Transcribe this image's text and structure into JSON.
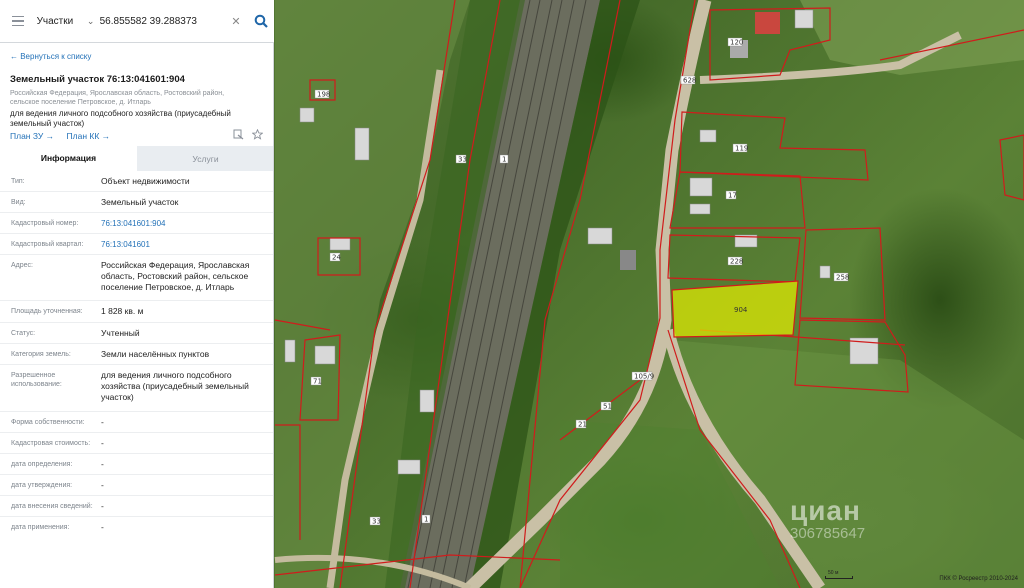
{
  "search": {
    "category": "Участки",
    "query": "56.855582 39.288373"
  },
  "sidebar": {
    "back_link": "← Вернуться к списку",
    "title": "Земельный участок 76:13:041601:904",
    "address": "Российская Федерация, Ярославская область, Ростовский район, сельское поселение Петровское, д. Итларь",
    "purpose": "для ведения личного подсобного хозяйства (приусадебный земельный участок)",
    "plan_links": [
      "План ЗУ →",
      "План КК →"
    ],
    "tabs": [
      {
        "label": "Информация",
        "active": true
      },
      {
        "label": "Услуги",
        "active": false
      }
    ],
    "rows": [
      {
        "label": "Тип:",
        "value": "Объект недвижимости",
        "link": false
      },
      {
        "label": "Вид:",
        "value": "Земельный участок",
        "link": false
      },
      {
        "label": "Кадастровый номер:",
        "value": "76:13:041601:904",
        "link": true
      },
      {
        "label": "Кадастровый квартал:",
        "value": "76:13:041601",
        "link": true
      },
      {
        "label": "Адрес:",
        "value": "Российская Федерация, Ярославская область, Ростовский район, сельское поселение Петровское, д. Итларь",
        "link": false
      },
      {
        "label": "Площадь уточненная:",
        "value": "1 828 кв. м",
        "link": false
      },
      {
        "label": "Статус:",
        "value": "Учтенный",
        "link": false
      },
      {
        "label": "Категория земель:",
        "value": "Земли населённых пунктов",
        "link": false
      },
      {
        "label": "Разрешенное использование:",
        "value": "для ведения личного подсобного хозяйства (приусадебный земельный участок)",
        "link": false
      },
      {
        "label": "Форма собственности:",
        "value": "-",
        "link": false
      },
      {
        "label": "Кадастровая стоимость:",
        "value": "-",
        "link": false
      },
      {
        "label": "дата определения:",
        "value": "-",
        "link": false
      },
      {
        "label": "дата утверждения:",
        "value": "-",
        "link": false
      },
      {
        "label": "дата внесения сведений:",
        "value": "-",
        "link": false
      },
      {
        "label": "дата применения:",
        "value": "-",
        "link": false
      }
    ]
  },
  "map": {
    "selected_parcel_label": "904",
    "parcel_labels": [
      "120",
      "628",
      "119",
      "17",
      "228",
      "258",
      "198",
      "24",
      "71",
      "33",
      "1",
      "105/9",
      "51",
      "21",
      "1",
      "33"
    ],
    "watermark": "циан",
    "watermark_id": "306785647",
    "scale_label": "50 м",
    "copyright": "ПКК © Росреестр 2010-2024"
  },
  "colors": {
    "accent": "#2472b8",
    "boundary": "#d01c1c",
    "selected_fill": "#e6f000"
  },
  "icons": [
    "menu-icon",
    "chevron-down-icon",
    "close-icon",
    "search-icon",
    "print-icon",
    "star-icon"
  ]
}
